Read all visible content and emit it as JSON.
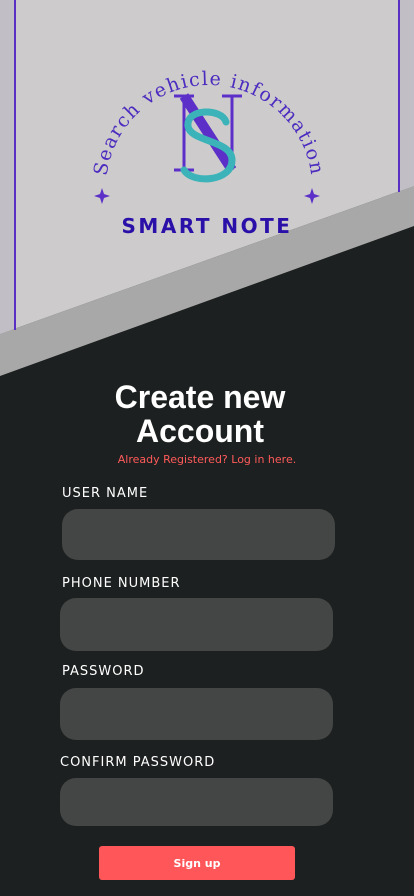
{
  "colors": {
    "top_background": "#cdcbcb",
    "gray_band": "#a8a8a8",
    "dark_background": "#1d2020",
    "frame_purple": "#5a2fc4",
    "brand_blue": "#2a0fa8",
    "logo_purple": "#5b2fc8",
    "logo_teal": "#3bb3b8",
    "accent_red": "#ff5a5a",
    "input_background": "#444545"
  },
  "logo": {
    "arc_text": "Search vehicle information",
    "monogram": "NS",
    "brand_name": "SMART NOTE"
  },
  "form": {
    "title_line1": "Create new",
    "title_line2": "Account",
    "login_link": "Already Registered? Log in here.",
    "fields": [
      {
        "label": "USER NAME",
        "value": ""
      },
      {
        "label": "PHONE NUMBER",
        "value": ""
      },
      {
        "label": "PASSWORD",
        "value": ""
      },
      {
        "label": "CONFIRM PASSWORD",
        "value": ""
      }
    ],
    "submit_label": "Sign up"
  }
}
